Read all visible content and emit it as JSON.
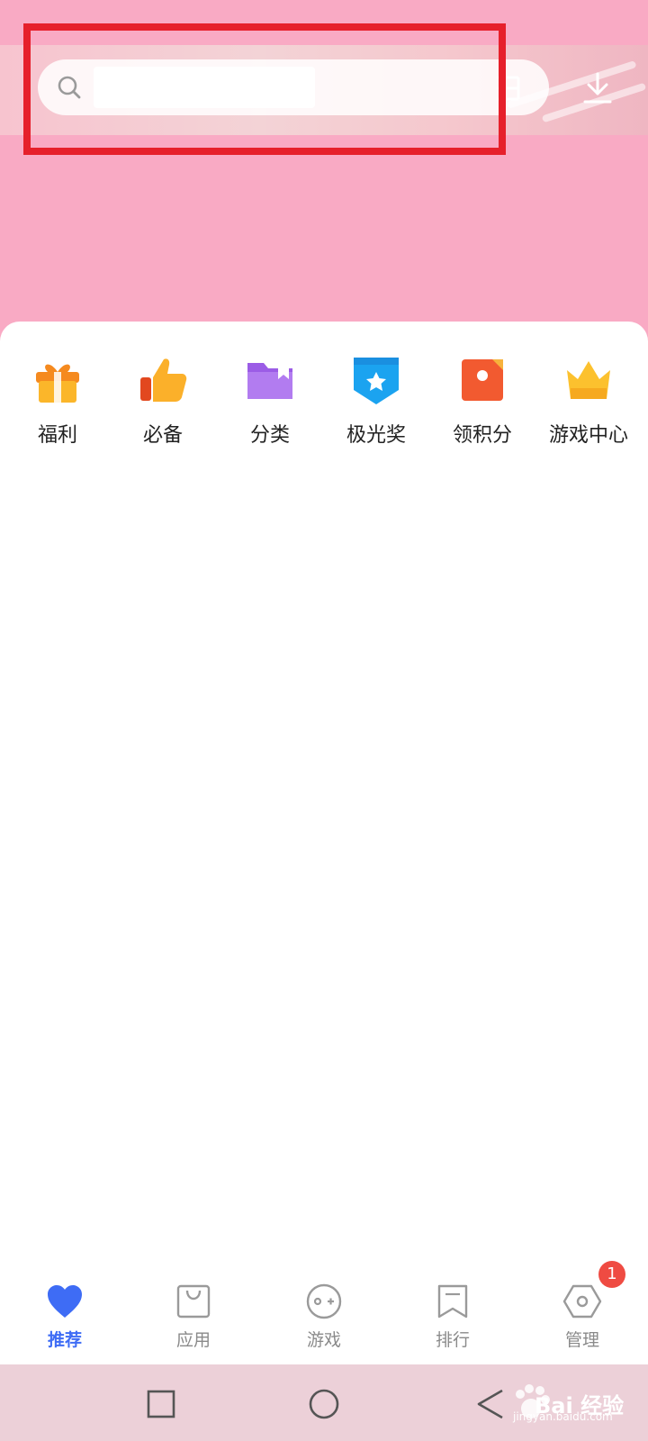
{
  "search": {
    "placeholder": ""
  },
  "header": {
    "icons": [
      "search-icon",
      "scan-icon",
      "download-icon"
    ]
  },
  "shortcuts": [
    {
      "label": "福利",
      "icon": "gift-icon"
    },
    {
      "label": "必备",
      "icon": "thumbs-up-icon"
    },
    {
      "label": "分类",
      "icon": "folder-icon"
    },
    {
      "label": "极光奖",
      "icon": "award-badge-icon"
    },
    {
      "label": "领积分",
      "icon": "points-card-icon"
    },
    {
      "label": "游戏中心",
      "icon": "crown-icon"
    }
  ],
  "bottom_nav": [
    {
      "label": "推荐",
      "icon": "heart-icon",
      "active": true
    },
    {
      "label": "应用",
      "icon": "shopping-bag-icon"
    },
    {
      "label": "游戏",
      "icon": "gamepad-icon"
    },
    {
      "label": "排行",
      "icon": "bookmark-icon"
    },
    {
      "label": "管理",
      "icon": "hexagon-icon",
      "badge": "1"
    }
  ],
  "system_nav": [
    "square-icon",
    "circle-icon",
    "back-triangle-icon"
  ],
  "watermark": {
    "text": "Bai 经验",
    "sub": "jingyan.baidu.com"
  },
  "colors": {
    "accent": "#3e6cf5",
    "header_pink": "#f9aac4",
    "badge": "#ef4b42",
    "highlight_frame": "#e6202b"
  }
}
